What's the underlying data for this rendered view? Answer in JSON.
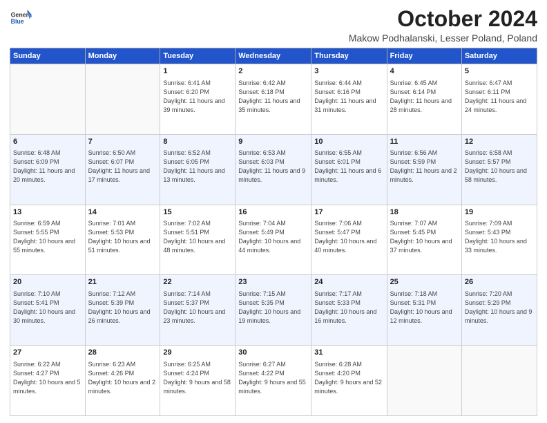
{
  "logo": {
    "line1": "General",
    "line2": "Blue"
  },
  "title": "October 2024",
  "location": "Makow Podhalanski, Lesser Poland, Poland",
  "days_of_week": [
    "Sunday",
    "Monday",
    "Tuesday",
    "Wednesday",
    "Thursday",
    "Friday",
    "Saturday"
  ],
  "weeks": [
    [
      {
        "day": "",
        "info": ""
      },
      {
        "day": "",
        "info": ""
      },
      {
        "day": "1",
        "info": "Sunrise: 6:41 AM\nSunset: 6:20 PM\nDaylight: 11 hours and 39 minutes."
      },
      {
        "day": "2",
        "info": "Sunrise: 6:42 AM\nSunset: 6:18 PM\nDaylight: 11 hours and 35 minutes."
      },
      {
        "day": "3",
        "info": "Sunrise: 6:44 AM\nSunset: 6:16 PM\nDaylight: 11 hours and 31 minutes."
      },
      {
        "day": "4",
        "info": "Sunrise: 6:45 AM\nSunset: 6:14 PM\nDaylight: 11 hours and 28 minutes."
      },
      {
        "day": "5",
        "info": "Sunrise: 6:47 AM\nSunset: 6:11 PM\nDaylight: 11 hours and 24 minutes."
      }
    ],
    [
      {
        "day": "6",
        "info": "Sunrise: 6:48 AM\nSunset: 6:09 PM\nDaylight: 11 hours and 20 minutes."
      },
      {
        "day": "7",
        "info": "Sunrise: 6:50 AM\nSunset: 6:07 PM\nDaylight: 11 hours and 17 minutes."
      },
      {
        "day": "8",
        "info": "Sunrise: 6:52 AM\nSunset: 6:05 PM\nDaylight: 11 hours and 13 minutes."
      },
      {
        "day": "9",
        "info": "Sunrise: 6:53 AM\nSunset: 6:03 PM\nDaylight: 11 hours and 9 minutes."
      },
      {
        "day": "10",
        "info": "Sunrise: 6:55 AM\nSunset: 6:01 PM\nDaylight: 11 hours and 6 minutes."
      },
      {
        "day": "11",
        "info": "Sunrise: 6:56 AM\nSunset: 5:59 PM\nDaylight: 11 hours and 2 minutes."
      },
      {
        "day": "12",
        "info": "Sunrise: 6:58 AM\nSunset: 5:57 PM\nDaylight: 10 hours and 58 minutes."
      }
    ],
    [
      {
        "day": "13",
        "info": "Sunrise: 6:59 AM\nSunset: 5:55 PM\nDaylight: 10 hours and 55 minutes."
      },
      {
        "day": "14",
        "info": "Sunrise: 7:01 AM\nSunset: 5:53 PM\nDaylight: 10 hours and 51 minutes."
      },
      {
        "day": "15",
        "info": "Sunrise: 7:02 AM\nSunset: 5:51 PM\nDaylight: 10 hours and 48 minutes."
      },
      {
        "day": "16",
        "info": "Sunrise: 7:04 AM\nSunset: 5:49 PM\nDaylight: 10 hours and 44 minutes."
      },
      {
        "day": "17",
        "info": "Sunrise: 7:06 AM\nSunset: 5:47 PM\nDaylight: 10 hours and 40 minutes."
      },
      {
        "day": "18",
        "info": "Sunrise: 7:07 AM\nSunset: 5:45 PM\nDaylight: 10 hours and 37 minutes."
      },
      {
        "day": "19",
        "info": "Sunrise: 7:09 AM\nSunset: 5:43 PM\nDaylight: 10 hours and 33 minutes."
      }
    ],
    [
      {
        "day": "20",
        "info": "Sunrise: 7:10 AM\nSunset: 5:41 PM\nDaylight: 10 hours and 30 minutes."
      },
      {
        "day": "21",
        "info": "Sunrise: 7:12 AM\nSunset: 5:39 PM\nDaylight: 10 hours and 26 minutes."
      },
      {
        "day": "22",
        "info": "Sunrise: 7:14 AM\nSunset: 5:37 PM\nDaylight: 10 hours and 23 minutes."
      },
      {
        "day": "23",
        "info": "Sunrise: 7:15 AM\nSunset: 5:35 PM\nDaylight: 10 hours and 19 minutes."
      },
      {
        "day": "24",
        "info": "Sunrise: 7:17 AM\nSunset: 5:33 PM\nDaylight: 10 hours and 16 minutes."
      },
      {
        "day": "25",
        "info": "Sunrise: 7:18 AM\nSunset: 5:31 PM\nDaylight: 10 hours and 12 minutes."
      },
      {
        "day": "26",
        "info": "Sunrise: 7:20 AM\nSunset: 5:29 PM\nDaylight: 10 hours and 9 minutes."
      }
    ],
    [
      {
        "day": "27",
        "info": "Sunrise: 6:22 AM\nSunset: 4:27 PM\nDaylight: 10 hours and 5 minutes."
      },
      {
        "day": "28",
        "info": "Sunrise: 6:23 AM\nSunset: 4:26 PM\nDaylight: 10 hours and 2 minutes."
      },
      {
        "day": "29",
        "info": "Sunrise: 6:25 AM\nSunset: 4:24 PM\nDaylight: 9 hours and 58 minutes."
      },
      {
        "day": "30",
        "info": "Sunrise: 6:27 AM\nSunset: 4:22 PM\nDaylight: 9 hours and 55 minutes."
      },
      {
        "day": "31",
        "info": "Sunrise: 6:28 AM\nSunset: 4:20 PM\nDaylight: 9 hours and 52 minutes."
      },
      {
        "day": "",
        "info": ""
      },
      {
        "day": "",
        "info": ""
      }
    ]
  ]
}
